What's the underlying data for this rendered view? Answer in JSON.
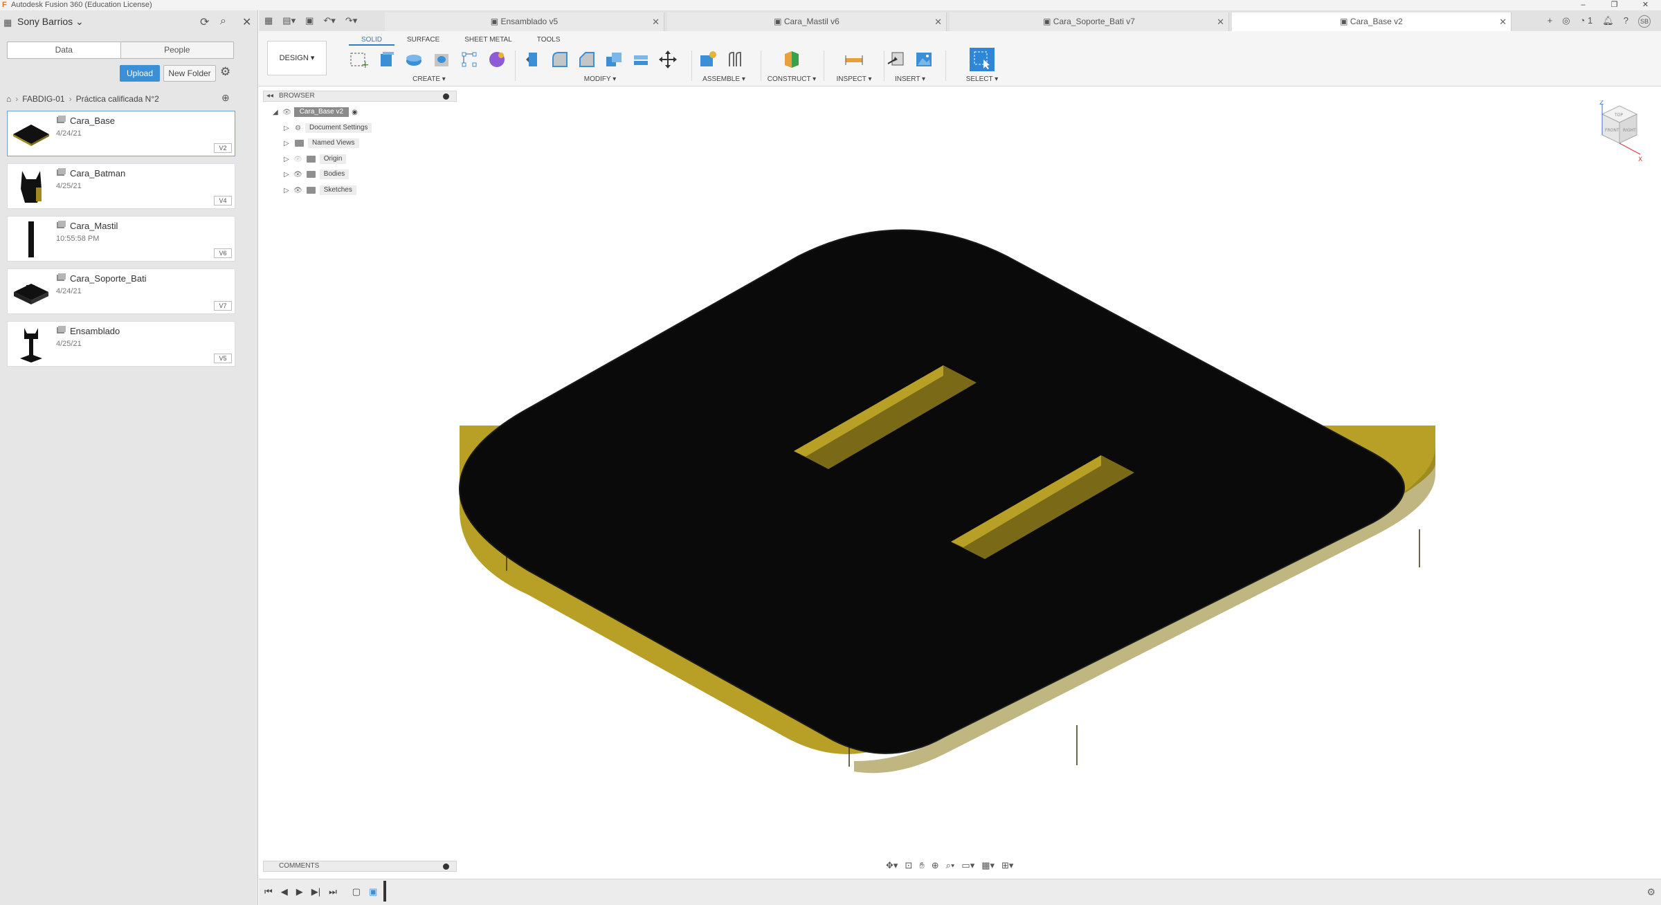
{
  "window": {
    "title": "Autodesk Fusion 360 (Education License)",
    "controls": [
      "–",
      "❐",
      "✕"
    ]
  },
  "datapanel": {
    "user": "Sony Barrios",
    "tabs": [
      {
        "label": "Data"
      },
      {
        "label": "People"
      }
    ],
    "upload_label": "Upload",
    "new_folder_label": "New Folder",
    "breadcrumb": [
      "FABDIG-01",
      "Práctica calificada N°2"
    ],
    "files": [
      {
        "name": "Cara_Base",
        "date": "4/24/21",
        "version": "V2"
      },
      {
        "name": "Cara_Batman",
        "date": "4/25/21",
        "version": "V4"
      },
      {
        "name": "Cara_Mastil",
        "date": "10:55:58 PM",
        "version": "V6"
      },
      {
        "name": "Cara_Soporte_Bati",
        "date": "4/24/21",
        "version": "V7"
      },
      {
        "name": "Ensamblado",
        "date": "4/25/21",
        "version": "V5"
      }
    ]
  },
  "doctabs": [
    {
      "label": "Ensamblado v5"
    },
    {
      "label": "Cara_Mastil v6"
    },
    {
      "label": "Cara_Soporte_Bati v7"
    },
    {
      "label": "Cara_Base v2"
    }
  ],
  "toolbar": {
    "workspace": "DESIGN",
    "tabs": [
      "SOLID",
      "SURFACE",
      "SHEET METAL",
      "TOOLS"
    ],
    "groups": [
      "CREATE",
      "MODIFY",
      "ASSEMBLE",
      "CONSTRUCT",
      "INSPECT",
      "INSERT",
      "SELECT"
    ]
  },
  "browser": {
    "title": "BROWSER",
    "root": "Cara_Base v2",
    "items": [
      "Document Settings",
      "Named Views",
      "Origin",
      "Bodies",
      "Sketches"
    ]
  },
  "comments": {
    "title": "COMMENTS"
  },
  "viewcube": {
    "top": "TOP",
    "front": "FRONT",
    "right": "RIGHT",
    "x": "X",
    "z": "Z"
  },
  "user_initials": "SB",
  "notification_count": "1",
  "colors": {
    "accent": "#3a8fd6",
    "model_top": "#0a0a0a",
    "model_side": "#b8a027"
  }
}
